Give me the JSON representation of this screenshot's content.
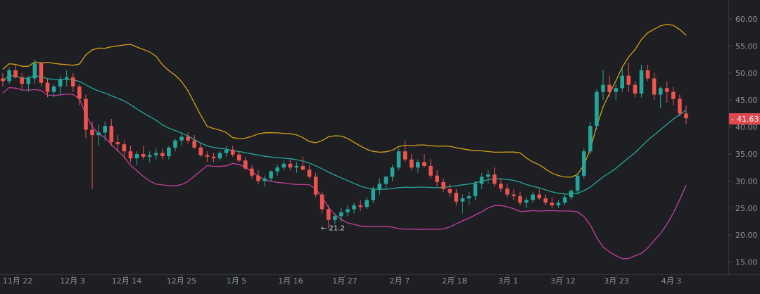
{
  "chart_data": {
    "type": "candlestick",
    "indicator": "bollinger_bands",
    "x_ticks": [
      "11月 22",
      "12月 3",
      "12月 14",
      "12月 25",
      "1月 5",
      "1月 16",
      "1月 27",
      "2月 7",
      "2月 18",
      "3月 1",
      "3月 12",
      "3月 23",
      "4月 3"
    ],
    "y_ticks": [
      "60.00",
      "55.00",
      "50.00",
      "45.00",
      "40.00",
      "35.00",
      "30.00",
      "25.00",
      "20.00",
      "15.00"
    ],
    "ylim": [
      13.5,
      62
    ],
    "current_price": "41.63",
    "low_marker": "← 21.2",
    "candles": [
      [
        49,
        50,
        47.5,
        48.5
      ],
      [
        48.5,
        51,
        48,
        50.5
      ],
      [
        50.5,
        51.5,
        49,
        49.2
      ],
      [
        49.2,
        50,
        47,
        48
      ],
      [
        48,
        49.5,
        46.5,
        49
      ],
      [
        49,
        52.5,
        48,
        51.8
      ],
      [
        51.8,
        52,
        47.5,
        48.2
      ],
      [
        48.2,
        49,
        45.5,
        46.5
      ],
      [
        46.5,
        48,
        45.5,
        47.5
      ],
      [
        47.5,
        49.5,
        46,
        48.8
      ],
      [
        48.8,
        50.5,
        47.5,
        49.2
      ],
      [
        49.2,
        50,
        46.5,
        47.5
      ],
      [
        47.5,
        48,
        44,
        45.2
      ],
      [
        45.2,
        46,
        38,
        39.5
      ],
      [
        39.5,
        41,
        28.5,
        38.5
      ],
      [
        38.5,
        40.5,
        36.5,
        39
      ],
      [
        39,
        41,
        37.5,
        40.2
      ],
      [
        40.2,
        41.5,
        36.5,
        37.2
      ],
      [
        37.2,
        38.5,
        35.5,
        36.8
      ],
      [
        36.8,
        37.5,
        34.2,
        35.5
      ],
      [
        35.5,
        36.5,
        33.5,
        34.2
      ],
      [
        34.2,
        35.5,
        33,
        35
      ],
      [
        35,
        36.5,
        34,
        34.5
      ],
      [
        34.5,
        35.5,
        33.5,
        34.8
      ],
      [
        34.8,
        36,
        34,
        35.2
      ],
      [
        35.2,
        36,
        34,
        34.6
      ],
      [
        34.6,
        36.5,
        34,
        36.2
      ],
      [
        36.2,
        37.8,
        35.5,
        37.5
      ],
      [
        37.5,
        38.8,
        36.5,
        38.2
      ],
      [
        38.2,
        39,
        37,
        37.5
      ],
      [
        37.5,
        38.5,
        36,
        36.2
      ],
      [
        36.2,
        37,
        34.5,
        34.8
      ],
      [
        34.8,
        35.5,
        33.5,
        34.5
      ],
      [
        34.5,
        35.2,
        33.5,
        34.2
      ],
      [
        34.2,
        35.5,
        33.8,
        35.2
      ],
      [
        35.2,
        36.5,
        34.5,
        35.8
      ],
      [
        35.8,
        36.5,
        34.5,
        34.9
      ],
      [
        34.9,
        35.5,
        33.5,
        33.8
      ],
      [
        33.8,
        34.5,
        32,
        32.3
      ],
      [
        32.3,
        33,
        30.5,
        31
      ],
      [
        31,
        32,
        29.5,
        30
      ],
      [
        30,
        31,
        29,
        30.5
      ],
      [
        30.5,
        32,
        30,
        31.8
      ],
      [
        31.8,
        33,
        31,
        32.5
      ],
      [
        32.5,
        33.8,
        32,
        33.2
      ],
      [
        33.2,
        34,
        32,
        32.5
      ],
      [
        32.5,
        33.5,
        31.5,
        32.8
      ],
      [
        32.8,
        34.5,
        32,
        32.1
      ],
      [
        32.1,
        33,
        30.5,
        30.8
      ],
      [
        30.8,
        31.5,
        27,
        27.5
      ],
      [
        27.5,
        28,
        24,
        24.8
      ],
      [
        24.8,
        25.5,
        21.2,
        22.8
      ],
      [
        22.8,
        24,
        22,
        23.5
      ],
      [
        23.5,
        25,
        22.5,
        24.2
      ],
      [
        24.2,
        25.5,
        23.5,
        24.8
      ],
      [
        24.8,
        26,
        24,
        25.5
      ],
      [
        25.5,
        26.5,
        24.5,
        25.2
      ],
      [
        25.2,
        27,
        24.8,
        26.5
      ],
      [
        26.5,
        29,
        26,
        28.5
      ],
      [
        28.5,
        30.5,
        27.5,
        29.5
      ],
      [
        29.5,
        31,
        28.5,
        30.8
      ],
      [
        30.8,
        33,
        30,
        32.5
      ],
      [
        32.5,
        36,
        32,
        35.5
      ],
      [
        35.5,
        37.5,
        33.5,
        34
      ],
      [
        34,
        35,
        32,
        32.5
      ],
      [
        32.5,
        34,
        31.5,
        33.5
      ],
      [
        33.5,
        35,
        32.5,
        32.8
      ],
      [
        32.8,
        34,
        30.5,
        31
      ],
      [
        31,
        32,
        29,
        29.8
      ],
      [
        29.8,
        30.5,
        28,
        28.5
      ],
      [
        28.5,
        29.5,
        27,
        27.8
      ],
      [
        27.8,
        28.5,
        25.5,
        26.2
      ],
      [
        26.2,
        27.5,
        24,
        26.8
      ],
      [
        26.8,
        28,
        25.5,
        27.2
      ],
      [
        27.2,
        30,
        26.5,
        29.5
      ],
      [
        29.5,
        31.5,
        28.5,
        30.8
      ],
      [
        30.8,
        32,
        29.5,
        31.2
      ],
      [
        31.2,
        32.5,
        29,
        29.5
      ],
      [
        29.5,
        30.5,
        28,
        28.6
      ],
      [
        28.6,
        29.5,
        27,
        27.5
      ],
      [
        27.5,
        28.5,
        26.5,
        27.2
      ],
      [
        27.2,
        28,
        25.5,
        26
      ],
      [
        26,
        27,
        25,
        26.5
      ],
      [
        26.5,
        28,
        26,
        27.5
      ],
      [
        27.5,
        28.5,
        26.5,
        26.8
      ],
      [
        26.8,
        27.5,
        25.5,
        26
      ],
      [
        26,
        27,
        25,
        25.5
      ],
      [
        25.5,
        26.5,
        25,
        26
      ],
      [
        26,
        27.5,
        25.5,
        27
      ],
      [
        27,
        28.5,
        26.5,
        28.2
      ],
      [
        28.2,
        31.5,
        27.5,
        31
      ],
      [
        31,
        36,
        30.5,
        35.5
      ],
      [
        35.5,
        41,
        35,
        40.2
      ],
      [
        40.2,
        47,
        39.5,
        46.5
      ],
      [
        46.5,
        50.5,
        45,
        47.8
      ],
      [
        47.8,
        49.5,
        45.5,
        46.5
      ],
      [
        46.5,
        48,
        45,
        47.2
      ],
      [
        47.2,
        51,
        46.5,
        49.5
      ],
      [
        49.5,
        52,
        46.5,
        47.8
      ],
      [
        47.8,
        48.5,
        45.5,
        46.2
      ],
      [
        46.2,
        51.5,
        45.5,
        50.5
      ],
      [
        50.5,
        51.5,
        48.5,
        49
      ],
      [
        49,
        50,
        45,
        46
      ],
      [
        46,
        47.5,
        43.5,
        47.2
      ],
      [
        47.2,
        48.5,
        44.5,
        46.5
      ],
      [
        46.5,
        47.5,
        44,
        45.2
      ],
      [
        45.2,
        46,
        42,
        42.5
      ],
      [
        42.5,
        44,
        40.5,
        41.63
      ]
    ]
  }
}
